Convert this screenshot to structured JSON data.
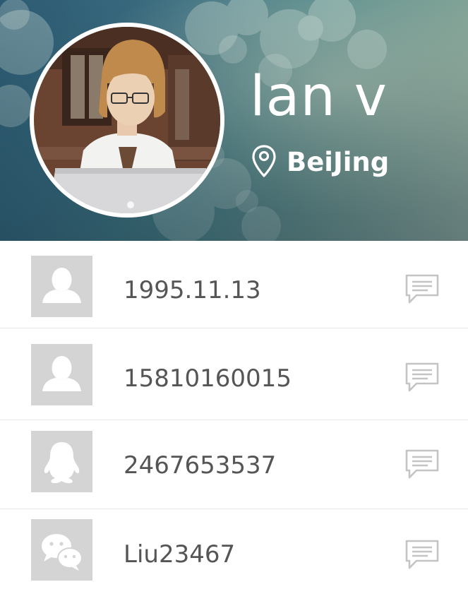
{
  "profile": {
    "name": "lan v",
    "location": "BeiJing",
    "location_icon": "map-pin-icon",
    "avatar": "profile-photo"
  },
  "contact_items": [
    {
      "type": "birthday",
      "icon": "person-icon",
      "value": "1995.11.13",
      "action_icon": "message-icon"
    },
    {
      "type": "phone",
      "icon": "person-icon",
      "value": "15810160015",
      "action_icon": "message-icon"
    },
    {
      "type": "qq",
      "icon": "qq-penguin-icon",
      "value": "2467653537",
      "action_icon": "message-icon"
    },
    {
      "type": "wechat",
      "icon": "wechat-icon",
      "value": "Liu23467",
      "action_icon": "message-icon"
    }
  ],
  "colors": {
    "icon_box_bg": "#d4d4d4",
    "value_text": "#555555",
    "divider": "#e7e7e7",
    "message_icon": "#c4c4c4",
    "header_text": "#ffffff"
  }
}
